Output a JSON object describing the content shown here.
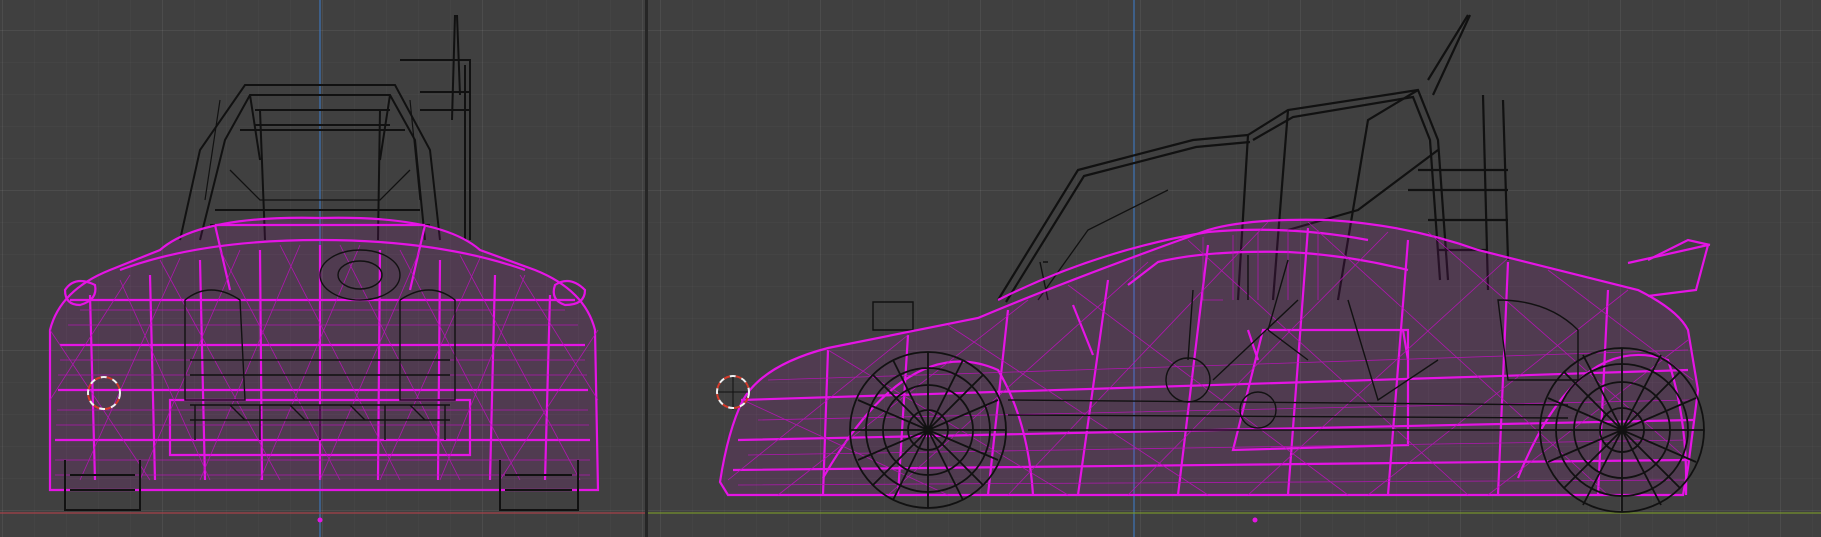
{
  "editor": {
    "views": [
      {
        "id": "front",
        "mode": "wireframe",
        "selected_object": "car-body"
      },
      {
        "id": "side",
        "mode": "wireframe",
        "selected_object": "car-body"
      }
    ],
    "colors": {
      "background": "#404040",
      "grid": "#4a4a4a",
      "selected_wire": "#e514e5",
      "unselected_wire": "#111111",
      "axis_x": "#b0404a",
      "axis_y": "#7a9a2a",
      "axis_z": "#3e7ac4",
      "cursor_ring_a": "#d43a2a",
      "cursor_ring_b": "#f0f0f0"
    }
  }
}
